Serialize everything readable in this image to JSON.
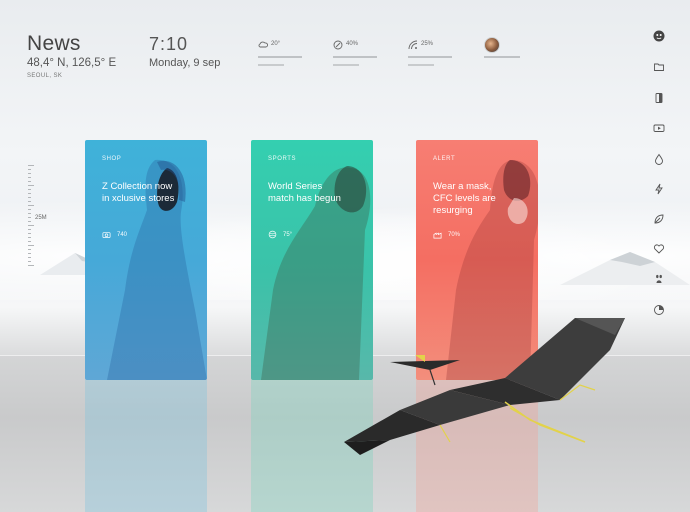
{
  "header": {
    "title": "News",
    "coords": "48,4° N, 126,5° E",
    "city": "SEOUL, SK",
    "time": "7:10",
    "date": "Monday, 9 sep"
  },
  "stats": [
    {
      "icon": "cloud-icon",
      "value": "20°"
    },
    {
      "icon": "percent-icon",
      "value": "40%"
    },
    {
      "icon": "signal-icon",
      "value": "25%"
    }
  ],
  "ruler": {
    "label": "25M"
  },
  "sidebar_icons": [
    "user-face-icon",
    "folder-icon",
    "document-icon",
    "video-icon",
    "drop-icon",
    "bolt-icon",
    "leaf-icon",
    "heart-icon",
    "paw-icon",
    "pie-chart-icon"
  ],
  "cards": [
    {
      "category": "SHOP",
      "headline": "Z Collection now in xclusive stores",
      "meta_icon": "camera-icon",
      "meta_value": "740",
      "color": "#3fb2d9"
    },
    {
      "category": "SPORTS",
      "headline": "World Series match has begun",
      "meta_icon": "ball-icon",
      "meta_value": "75°",
      "color": "#34cfb0"
    },
    {
      "category": "ALERT",
      "headline": "Wear a mask, CFC levels are resurging",
      "meta_icon": "factory-icon",
      "meta_value": "70%",
      "color": "#f77e73"
    }
  ]
}
